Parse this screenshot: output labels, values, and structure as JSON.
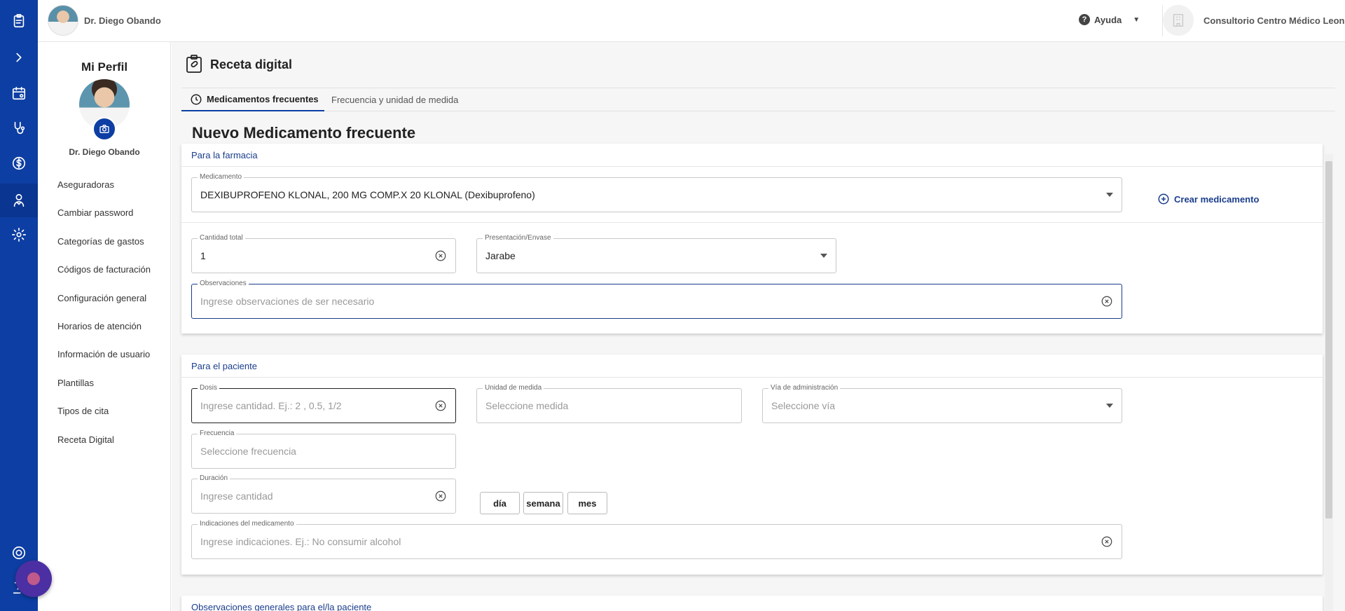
{
  "topbar": {
    "user_name": "Dr. Diego Obando",
    "help_label": "Ayuda",
    "clinic_name": "Consultorio Centro Médico Leon"
  },
  "sidebar_icons": [
    "clipboard-icon",
    "chevron-right-icon",
    "calendar-icon",
    "stethoscope-icon",
    "dollar-icon",
    "doctor-icon",
    "gear-icon",
    "support-icon",
    "logout-icon"
  ],
  "profile": {
    "title": "Mi Perfil",
    "name": "Dr. Diego Obando",
    "menu": [
      {
        "label": "Aseguradoras"
      },
      {
        "label": "Cambiar password"
      },
      {
        "label": "Categorías de gastos"
      },
      {
        "label": "Códigos de facturación"
      },
      {
        "label": "Configuración general"
      },
      {
        "label": "Horarios de atención"
      },
      {
        "label": "Información de usuario"
      },
      {
        "label": "Plantillas"
      },
      {
        "label": "Tipos de cita"
      },
      {
        "label": "Receta Digital"
      }
    ]
  },
  "page": {
    "title": "Receta digital",
    "tabs": [
      {
        "label": "Medicamentos frecuentes"
      },
      {
        "label": "Frecuencia y unidad de medida"
      }
    ],
    "section_title": "Nuevo Medicamento frecuente"
  },
  "farmacia": {
    "header": "Para la farmacia",
    "medicamento": {
      "label": "Medicamento",
      "value": "DEXIBUPROFENO KLONAL, 200 MG COMP.X 20 KLONAL (Dexibuprofeno)"
    },
    "crear_label": "Crear medicamento",
    "cantidad": {
      "label": "Cantidad total",
      "value": "1"
    },
    "presentacion": {
      "label": "Presentación/Envase",
      "value": "Jarabe"
    },
    "observaciones": {
      "label": "Observaciones",
      "placeholder": "Ingrese observaciones de ser necesario"
    }
  },
  "paciente": {
    "header": "Para el paciente",
    "dosis": {
      "label": "Dosis",
      "placeholder": "Ingrese cantidad. Ej.: 2 , 0.5, 1/2"
    },
    "unidad": {
      "label": "Unidad de medida",
      "placeholder": "Seleccione medida"
    },
    "via": {
      "label": "Vía de administración",
      "placeholder": "Seleccione vía"
    },
    "frecuencia": {
      "label": "Frecuencia",
      "placeholder": "Seleccione frecuencia"
    },
    "duracion": {
      "label": "Duración",
      "placeholder": "Ingrese cantidad"
    },
    "duracion_units": [
      "día",
      "semana",
      "mes"
    ],
    "indicaciones": {
      "label": "Indicaciones del medicamento",
      "placeholder": "Ingrese indicaciones. Ej.: No consumir alcohol"
    }
  },
  "generales": {
    "header": "Observaciones generales para el/la paciente"
  },
  "colors": {
    "rail": "#0d3ea3",
    "accent": "#1a3d8c"
  }
}
